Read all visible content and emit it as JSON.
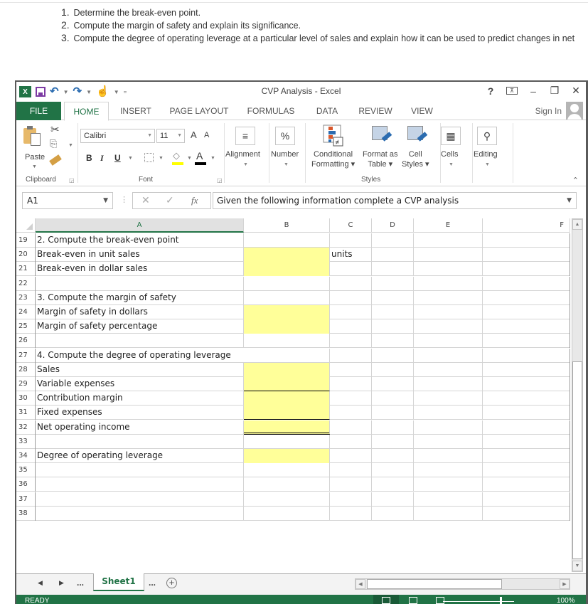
{
  "instructions": [
    {
      "num": "1.",
      "text": "Determine the break-even point."
    },
    {
      "num": "2.",
      "text": "Compute the margin of safety and explain its significance."
    },
    {
      "num": "3.",
      "text": "Compute the degree of operating leverage at a particular level of sales and explain how it can be used to predict changes in net"
    }
  ],
  "window": {
    "title": "CVP Analysis - Excel",
    "help": "?",
    "minimize": "–",
    "restore": "❐",
    "close": "✕",
    "ribbon_display": "⊼"
  },
  "qat": {
    "excel_logo": "X",
    "undo": "↶",
    "redo": "↷",
    "touch": "☝",
    "customize": "="
  },
  "tabs": {
    "file": "FILE",
    "items": [
      "HOME",
      "INSERT",
      "PAGE LAYOUT",
      "FORMULAS",
      "DATA",
      "REVIEW",
      "VIEW"
    ],
    "active": "HOME",
    "sign_in": "Sign In"
  },
  "ribbon": {
    "clipboard": {
      "paste": "Paste",
      "group": "Clipboard"
    },
    "font": {
      "name": "Calibri",
      "size": "11",
      "bold": "B",
      "italic": "I",
      "underline": "U",
      "grow": "A",
      "shrink": "A",
      "font_color": "A",
      "group": "Font"
    },
    "alignment": {
      "label": "Alignment",
      "icon": "≡"
    },
    "number": {
      "label": "Number",
      "icon": "%"
    },
    "styles": {
      "conditional_formatting": [
        "Conditional",
        "Formatting"
      ],
      "format_as_table": [
        "Format as",
        "Table"
      ],
      "cell_styles": [
        "Cell",
        "Styles"
      ],
      "group": "Styles"
    },
    "cells": {
      "label": "Cells"
    },
    "editing": {
      "label": "Editing"
    }
  },
  "formula_bar": {
    "name_box": "A1",
    "cancel": "✕",
    "enter": "✓",
    "fx": "fx",
    "formula": "Given the following information complete a CVP analysis"
  },
  "sheet": {
    "columns": [
      "A",
      "B",
      "C",
      "D",
      "E",
      "F"
    ],
    "selected_column": "A",
    "rows": [
      {
        "num": "19",
        "A": "2. Compute the break-even point",
        "B": "",
        "C": "",
        "yellow": false
      },
      {
        "num": "20",
        "A": "Break-even in unit sales",
        "B": "",
        "C": "units",
        "yellow": true
      },
      {
        "num": "21",
        "A": "Break-even in dollar sales",
        "B": "",
        "C": "",
        "yellow": true
      },
      {
        "num": "22",
        "A": "",
        "B": "",
        "C": "",
        "yellow": false
      },
      {
        "num": "23",
        "A": "3. Compute the margin of safety",
        "B": "",
        "C": "",
        "yellow": false
      },
      {
        "num": "24",
        "A": "Margin of safety in dollars",
        "B": "",
        "C": "",
        "yellow": true
      },
      {
        "num": "25",
        "A": "Margin of safety percentage",
        "B": "",
        "C": "",
        "yellow": true
      },
      {
        "num": "26",
        "A": "",
        "B": "",
        "C": "",
        "yellow": false
      },
      {
        "num": "27",
        "A": "4. Compute the degree of operating leverage",
        "B": "",
        "C": "",
        "yellow": false
      },
      {
        "num": "28",
        "A": "Sales",
        "B": "",
        "C": "",
        "yellow": true
      },
      {
        "num": "29",
        "A": "Variable expenses",
        "B": "",
        "C": "",
        "yellow": true
      },
      {
        "num": "30",
        "A": "Contribution margin",
        "B": "",
        "C": "",
        "yellow": true
      },
      {
        "num": "31",
        "A": "Fixed expenses",
        "B": "",
        "C": "",
        "yellow": true
      },
      {
        "num": "32",
        "A": "Net operating income",
        "B": "",
        "C": "",
        "yellow": true
      },
      {
        "num": "33",
        "A": "",
        "B": "",
        "C": "",
        "yellow": false
      },
      {
        "num": "34",
        "A": "Degree of operating leverage",
        "B": "",
        "C": "",
        "yellow": true
      },
      {
        "num": "35",
        "A": "",
        "B": "",
        "C": "",
        "yellow": false
      },
      {
        "num": "36",
        "A": "",
        "B": "",
        "C": "",
        "yellow": false
      },
      {
        "num": "37",
        "A": "",
        "B": "",
        "C": "",
        "yellow": false
      },
      {
        "num": "38",
        "A": "",
        "B": "",
        "C": "",
        "yellow": false
      }
    ],
    "input_fill_color": "#ffff99"
  },
  "sheet_tabs": {
    "prev": "◀",
    "next": "▶",
    "more_left": "...",
    "active": "Sheet1",
    "more_right": "...",
    "add": "+"
  },
  "status": {
    "text": "READY",
    "zoom": "100%"
  },
  "colors": {
    "excel_green": "#217346",
    "input_yellow": "#ffff99"
  }
}
